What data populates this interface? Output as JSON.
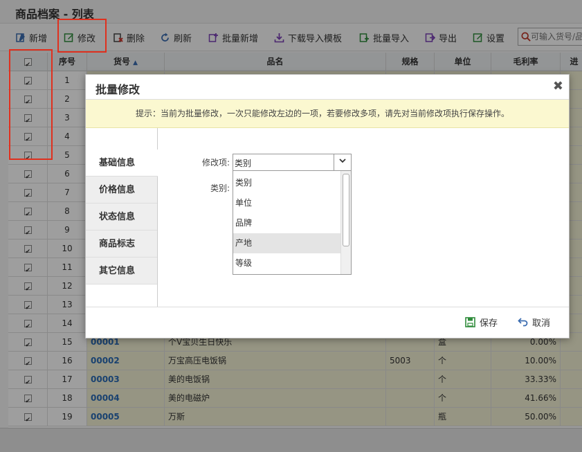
{
  "page": {
    "title": "商品档案 - 列表"
  },
  "toolbar": {
    "buttons": [
      {
        "label": "新增"
      },
      {
        "label": "修改"
      },
      {
        "label": "删除"
      },
      {
        "label": "刷新"
      },
      {
        "label": "批量新增"
      },
      {
        "label": "下载导入模板"
      },
      {
        "label": "批量导入"
      },
      {
        "label": "导出"
      },
      {
        "label": "设置"
      }
    ],
    "search_placeholder": "可输入货号/品名"
  },
  "grid": {
    "headers": {
      "seq": "序号",
      "code": "货号",
      "name": "品名",
      "spec": "规格",
      "unit": "单位",
      "margin": "毛利率",
      "last": "进"
    },
    "rows": [
      {
        "seq": "1"
      },
      {
        "seq": "2"
      },
      {
        "seq": "3"
      },
      {
        "seq": "4"
      },
      {
        "seq": "5"
      },
      {
        "seq": "6"
      },
      {
        "seq": "7"
      },
      {
        "seq": "8"
      },
      {
        "seq": "9"
      },
      {
        "seq": "10"
      },
      {
        "seq": "11"
      },
      {
        "seq": "12"
      },
      {
        "seq": "13"
      },
      {
        "seq": "14"
      },
      {
        "seq": "15",
        "code": "00001",
        "name": "个V宝贝生日快乐",
        "spec": "",
        "unit": "盒",
        "margin": "0.00%"
      },
      {
        "seq": "16",
        "code": "00002",
        "name": "万宝高压电饭锅",
        "spec": "5003",
        "unit": "个",
        "margin": "10.00%"
      },
      {
        "seq": "17",
        "code": "00003",
        "name": "美的电饭锅",
        "spec": "",
        "unit": "个",
        "margin": "33.33%"
      },
      {
        "seq": "18",
        "code": "00004",
        "name": "美的电磁炉",
        "spec": "",
        "unit": "个",
        "margin": "41.66%"
      },
      {
        "seq": "19",
        "code": "00005",
        "name": "万斯",
        "spec": "",
        "unit": "瓶",
        "margin": "50.00%"
      }
    ]
  },
  "modal": {
    "title": "批量修改",
    "close": "✖",
    "tip": "提示：当前为批量修改，一次只能修改左边的一项，若要修改多项，请先对当前修改项执行保存操作。",
    "tabs": [
      {
        "label": "基础信息"
      },
      {
        "label": "价格信息"
      },
      {
        "label": "状态信息"
      },
      {
        "label": "商品标志"
      },
      {
        "label": "其它信息"
      }
    ],
    "form": {
      "field_label": "修改项:",
      "field_value": "类别",
      "category_label": "类别:",
      "options": [
        "类别",
        "单位",
        "品牌",
        "产地",
        "等级"
      ]
    },
    "footer": {
      "save": "保存",
      "cancel": "取消"
    }
  },
  "colors": {
    "highlight": "#e0301e",
    "code_text": "#2a6bb5",
    "tip_bg": "#fbf8d0",
    "row_tint": "#f3f1d4"
  }
}
